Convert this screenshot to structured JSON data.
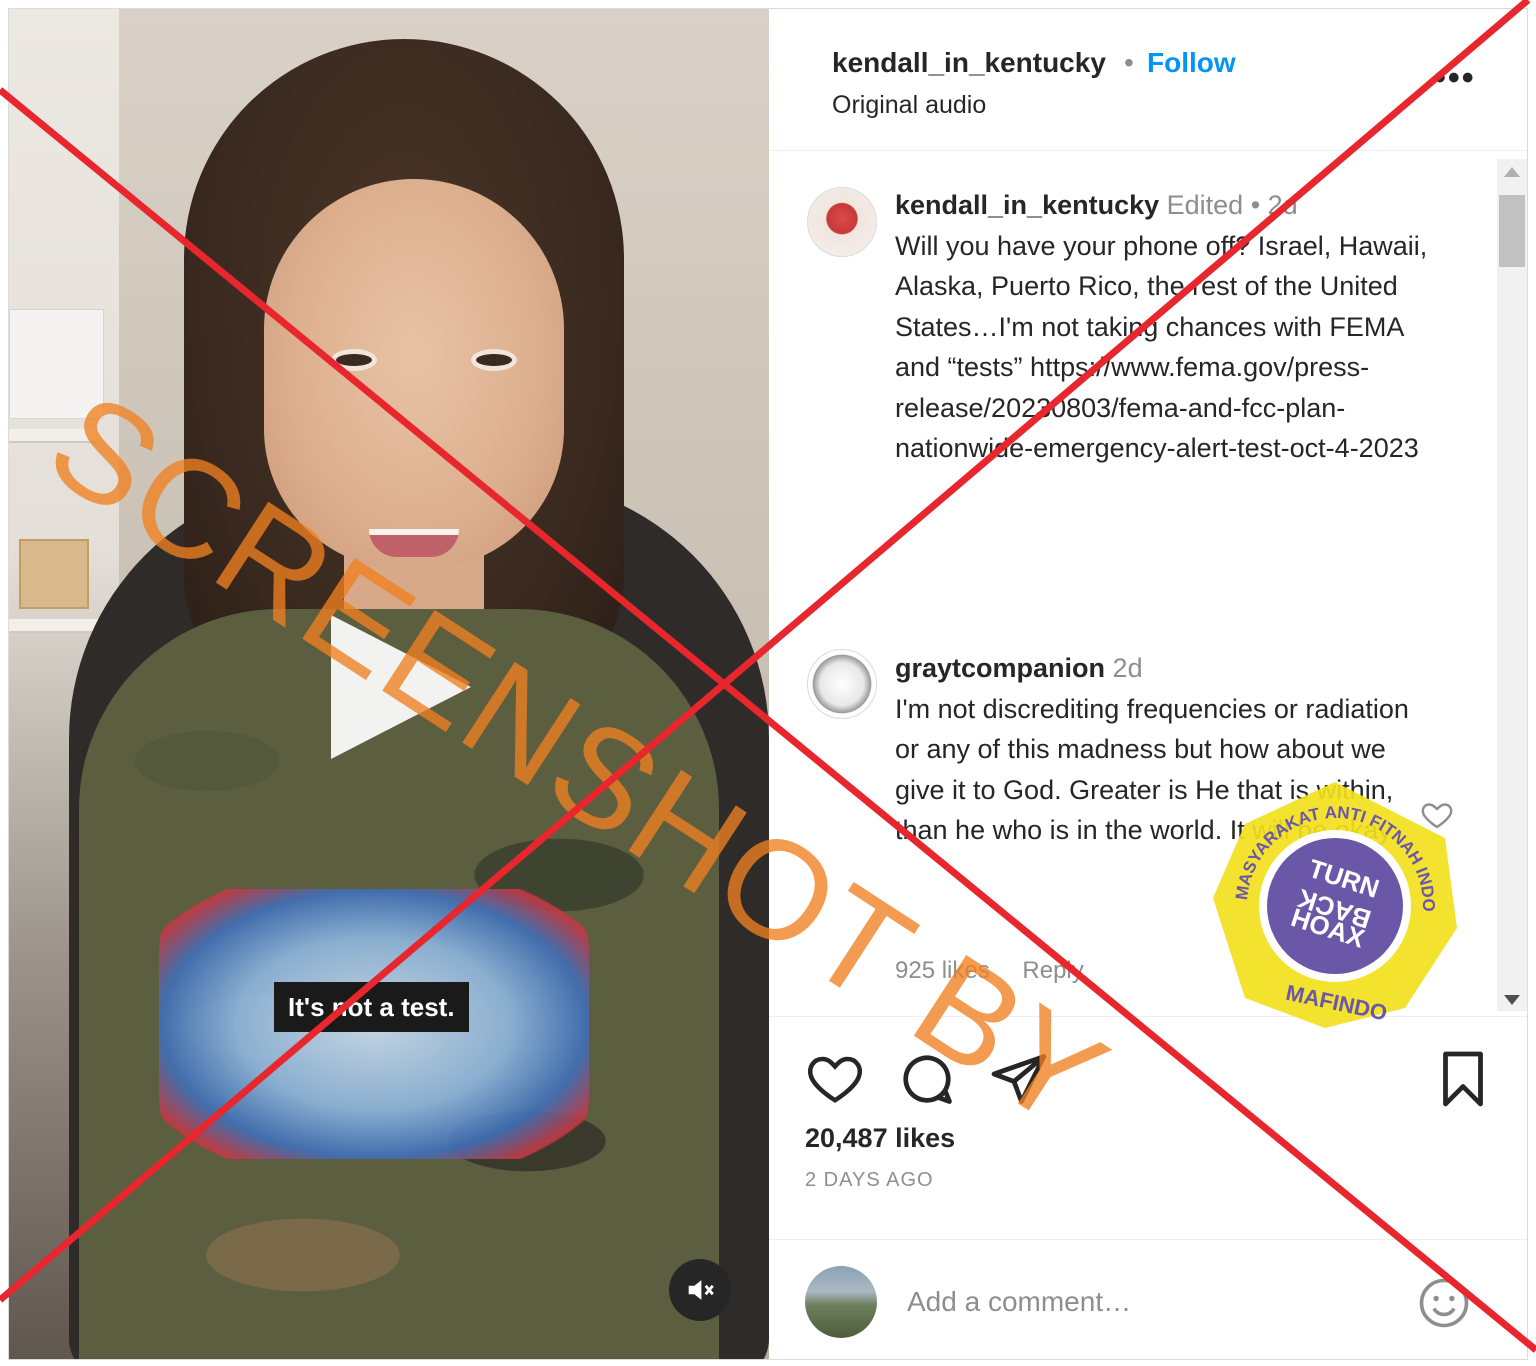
{
  "post": {
    "author": "kendall_in_kentucky",
    "follow_label": "Follow",
    "separator": "•",
    "audio": "Original audio",
    "more_label": "•••"
  },
  "video": {
    "caption": "It's not a test."
  },
  "comments": [
    {
      "username": "kendall_in_kentucky",
      "meta": "Edited • 2d",
      "text": "Will you have your phone off? Israel, Hawaii, Alaska, Puerto Rico, the rest of the United States…I'm not taking chances with FEMA and “tests” https://www.fema.gov/press-release/20230803/fema-and-fcc-plan-nationwide-emergency-alert-test-oct-4-2023"
    },
    {
      "username": "graytcompanion",
      "meta": "2d",
      "text": "I'm not discrediting frequencies or radiation or any of this madness but how about we give it to God. Greater is He that is within, than he who is in the world. It will be okay.",
      "likes": "925 likes",
      "reply": "Reply"
    }
  ],
  "engagement": {
    "likes": "20,487 likes",
    "posted": "2 DAYS AGO"
  },
  "comment_input": {
    "placeholder": "Add a comment…"
  },
  "overlays": {
    "watermark": "SCREENSHOT BY",
    "badge_ring_text": "MASYARAKAT ANTI FITNAH INDONESIA",
    "badge_center": [
      "TURN",
      "BACK",
      "HOAX"
    ],
    "badge_bottom": "MAFINDO"
  },
  "colors": {
    "accent": "#0095f6",
    "cross": "#e8262d",
    "watermark": "#f08020",
    "badge_yellow": "#f2e11c",
    "badge_purple": "#6b57a8"
  },
  "icons": [
    "heart-icon",
    "comment-icon",
    "share-icon",
    "bookmark-icon",
    "mute-icon",
    "play-icon",
    "emoji-icon",
    "more-icon"
  ]
}
